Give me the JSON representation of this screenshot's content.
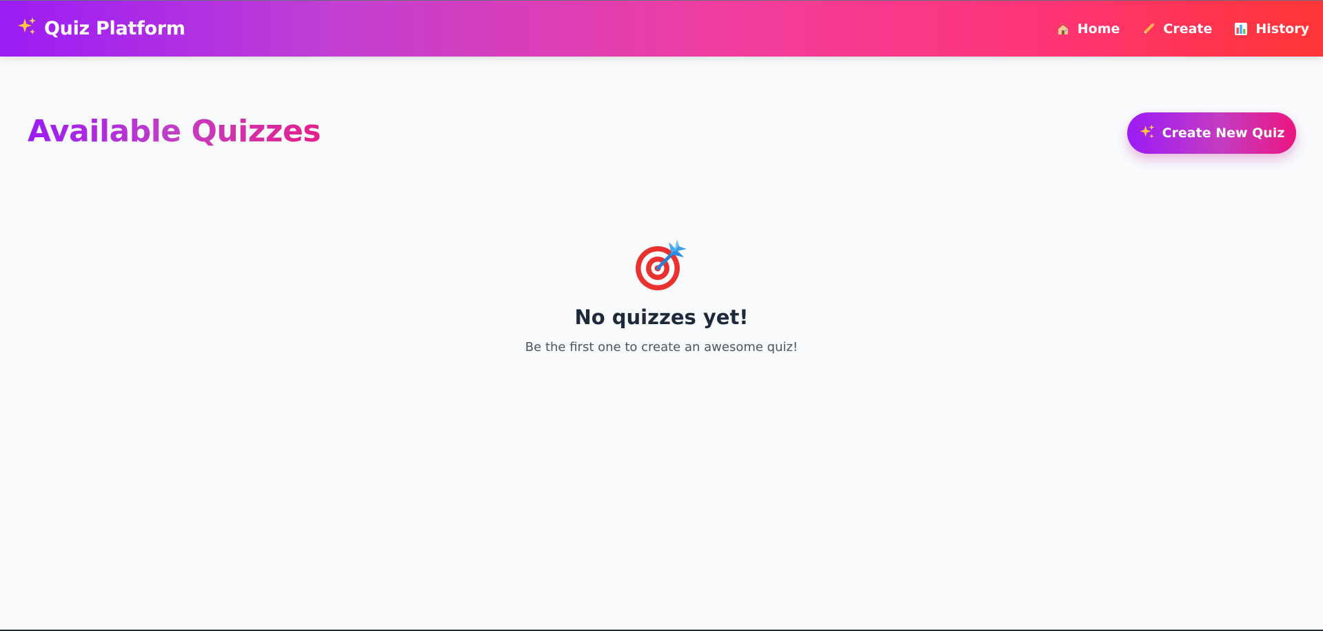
{
  "navbar": {
    "brand_icon": "sparkles-icon",
    "brand_title": "Quiz Platform",
    "links": [
      {
        "icon": "house-icon",
        "label": "Home"
      },
      {
        "icon": "pencil-icon",
        "label": "Create"
      },
      {
        "icon": "bar-chart-icon",
        "label": "History"
      }
    ],
    "gradient": [
      "#9b1cf5",
      "#f13d9f",
      "#ff3535"
    ]
  },
  "main": {
    "title": "Available Quizzes",
    "create_button": {
      "icon": "sparkles-icon",
      "label": "Create New Quiz"
    }
  },
  "empty_state": {
    "icon": "bullseye-dart-icon",
    "title": "No quizzes yet!",
    "subtitle": "Be the first one to create an awesome quiz!"
  },
  "colors": {
    "accent_purple": "#9b1cf5",
    "accent_pink": "#ec167f",
    "background": "#f8fafc",
    "text_dark": "#1e293b",
    "text_muted": "#4b5563"
  }
}
